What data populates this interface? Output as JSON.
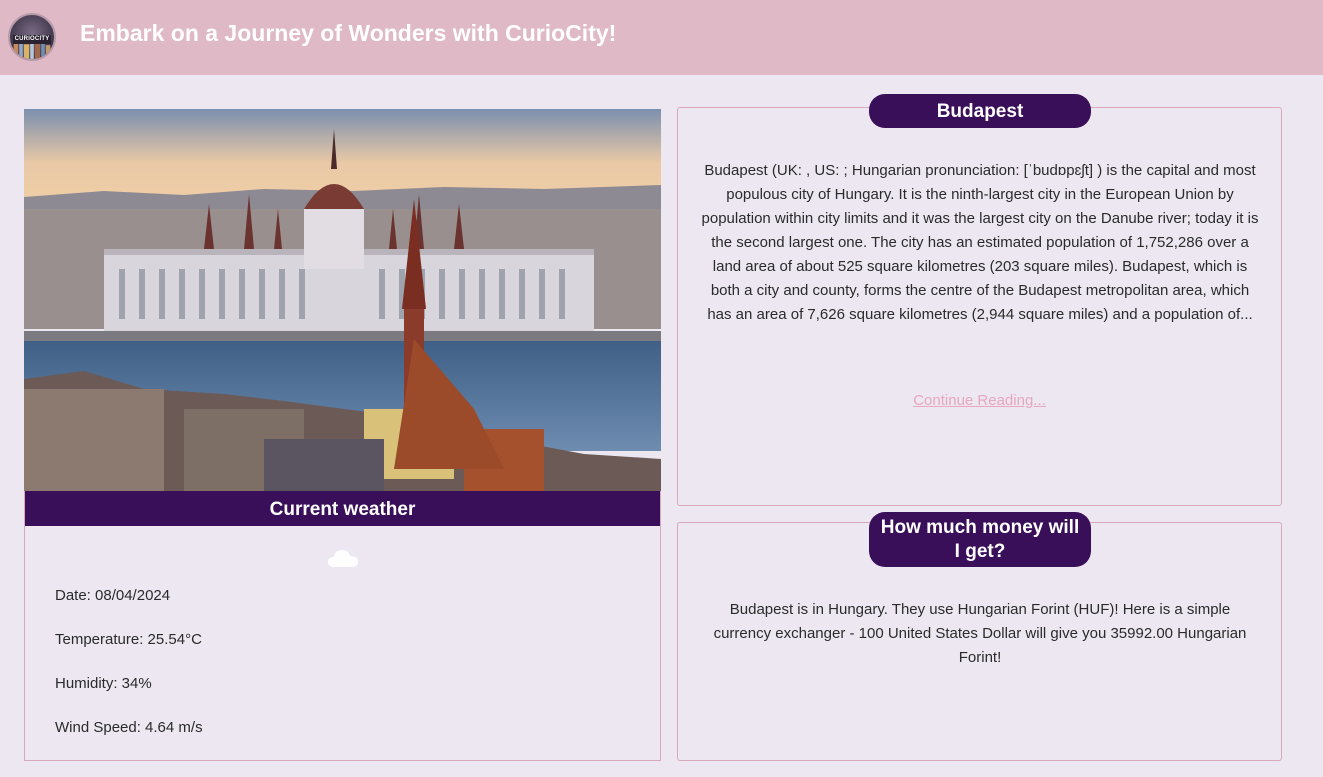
{
  "header": {
    "logo_text": "CURIOCITY",
    "title": "Embark on a Journey of Wonders with CurioCity!"
  },
  "weather": {
    "heading": "Current weather",
    "icon": "cloud-icon",
    "date": "Date: 08/04/2024",
    "temperature": "Temperature: 25.54°C",
    "humidity": "Humidity: 34%",
    "wind": "Wind Speed: 4.64 m/s"
  },
  "city": {
    "name": "Budapest",
    "description": "Budapest (UK: , US: ; Hungarian pronunciation: [ˈbudɒpɛʃt] ) is the capital and most populous city of Hungary. It is the ninth-largest city in the European Union by population within city limits and it was the largest city on the Danube river; today it is the second largest one. The city has an estimated population of 1,752,286 over a land area of about 525 square kilometres (203 square miles). Budapest, which is both a city and county, forms the centre of the Budapest metropolitan area, which has an area of 7,626 square kilometres (2,944 square miles) and a population of...",
    "continue_label": "Continue Reading..."
  },
  "money": {
    "heading": "How much money will I get?",
    "text": "Budapest is in Hungary. They use Hungarian Forint (HUF)! Here is a simple currency exchanger - 100 United States Dollar will give you 35992.00 Hungarian Forint!"
  },
  "colors": {
    "header_bg": "#dfb9c6",
    "accent": "#3a0f5a",
    "link": "#e8a6c0",
    "page_bg": "#ece7f0"
  }
}
